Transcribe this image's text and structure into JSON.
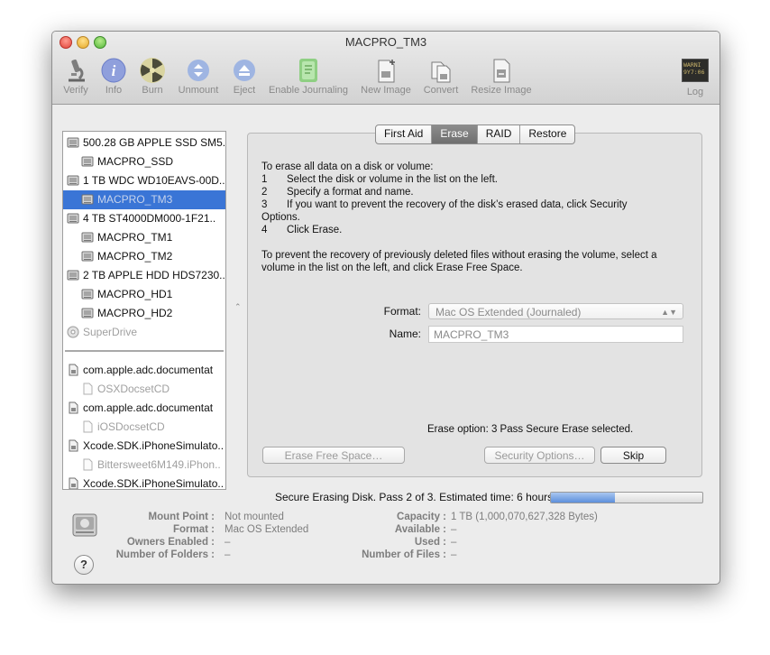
{
  "window": {
    "title": "MACPRO_TM3"
  },
  "toolbar": {
    "items": [
      {
        "label": "Verify",
        "icon": "microscope-icon"
      },
      {
        "label": "Info",
        "icon": "info-icon"
      },
      {
        "label": "Burn",
        "icon": "radiation-burn-icon"
      },
      {
        "label": "Unmount",
        "icon": "unmount-icon"
      },
      {
        "label": "Eject",
        "icon": "eject-icon"
      },
      {
        "label": "Enable Journaling",
        "icon": "journal-icon"
      },
      {
        "label": "New Image",
        "icon": "new-image-icon"
      },
      {
        "label": "Convert",
        "icon": "convert-icon"
      },
      {
        "label": "Resize Image",
        "icon": "resize-image-icon"
      },
      {
        "label": "Log",
        "icon": "log-console-icon",
        "console_text": "WARNI\n9Y7:06"
      }
    ]
  },
  "sidebar": {
    "items": [
      {
        "label": "500.28 GB APPLE SSD SM5..",
        "kind": "disk",
        "dim": false,
        "selected": false
      },
      {
        "label": "MACPRO_SSD",
        "kind": "volume",
        "dim": false,
        "selected": false
      },
      {
        "label": "1 TB WDC WD10EAVS-00D..",
        "kind": "disk",
        "dim": false,
        "selected": false
      },
      {
        "label": "MACPRO_TM3",
        "kind": "volume",
        "dim": false,
        "selected": true
      },
      {
        "label": "4 TB ST4000DM000-1F21..",
        "kind": "disk",
        "dim": false,
        "selected": false
      },
      {
        "label": "MACPRO_TM1",
        "kind": "volume",
        "dim": false,
        "selected": false
      },
      {
        "label": "MACPRO_TM2",
        "kind": "volume",
        "dim": false,
        "selected": false
      },
      {
        "label": "2 TB APPLE HDD HDS7230..",
        "kind": "disk",
        "dim": false,
        "selected": false
      },
      {
        "label": "MACPRO_HD1",
        "kind": "volume",
        "dim": false,
        "selected": false
      },
      {
        "label": "MACPRO_HD2",
        "kind": "volume",
        "dim": false,
        "selected": false
      },
      {
        "label": "SuperDrive",
        "kind": "optical",
        "dim": true,
        "selected": false
      },
      {
        "label": "com.apple.adc.documentat",
        "kind": "image",
        "dim": false,
        "selected": false
      },
      {
        "label": "OSXDocsetCD",
        "kind": "imgvol",
        "dim": true,
        "selected": false
      },
      {
        "label": "com.apple.adc.documentat",
        "kind": "image",
        "dim": false,
        "selected": false
      },
      {
        "label": "iOSDocsetCD",
        "kind": "imgvol",
        "dim": true,
        "selected": false
      },
      {
        "label": "Xcode.SDK.iPhoneSimulato..",
        "kind": "image",
        "dim": false,
        "selected": false
      },
      {
        "label": "Bittersweet6M149.iPhon..",
        "kind": "imgvol",
        "dim": true,
        "selected": false
      },
      {
        "label": "Xcode.SDK.iPhoneSimulato..",
        "kind": "image",
        "dim": false,
        "selected": false
      }
    ]
  },
  "tabs": [
    {
      "label": "First Aid",
      "active": false
    },
    {
      "label": "Erase",
      "active": true
    },
    {
      "label": "RAID",
      "active": false
    },
    {
      "label": "Restore",
      "active": false
    }
  ],
  "erase": {
    "intro": "To erase all data on a disk or volume:",
    "steps": [
      {
        "num": "1",
        "text": "Select the disk or volume in the list on the left."
      },
      {
        "num": "2",
        "text": "Specify a format and name."
      },
      {
        "num": "3",
        "text": "If you want to prevent the recovery of the disk’s erased data, click Security",
        "cont": "Options."
      },
      {
        "num": "4",
        "text": "Click Erase."
      }
    ],
    "free_space_note_1": "To prevent the recovery of previously deleted files without erasing the volume, select a",
    "free_space_note_2": "volume in the list on the left, and click Erase Free Space.",
    "format_label": "Format:",
    "format_value": "Mac OS Extended (Journaled)",
    "name_label": "Name:",
    "name_value": "MACPRO_TM3",
    "erase_option": "Erase option: 3 Pass Secure Erase selected.",
    "erase_free_space_button": "Erase Free Space…",
    "security_options_button": "Security Options…",
    "skip_button": "Skip"
  },
  "status": {
    "text": "Secure Erasing Disk. Pass 2 of 3. Estimated time: 6 hours",
    "progress": 0.42,
    "progress_color": "#5d8fdb"
  },
  "info": {
    "mount_point_key": "Mount Point :",
    "mount_point": "Not mounted",
    "format_key": "Format :",
    "format": "Mac OS Extended",
    "owners_key": "Owners Enabled :",
    "owners": "–",
    "folders_key": "Number of Folders :",
    "folders": "–",
    "capacity_key": "Capacity :",
    "capacity": "1 TB (1,000,070,627,328 Bytes)",
    "available_key": "Available :",
    "available": "–",
    "used_key": "Used :",
    "used": "–",
    "files_key": "Number of Files :",
    "files": "–"
  },
  "help": {
    "label": "?"
  }
}
